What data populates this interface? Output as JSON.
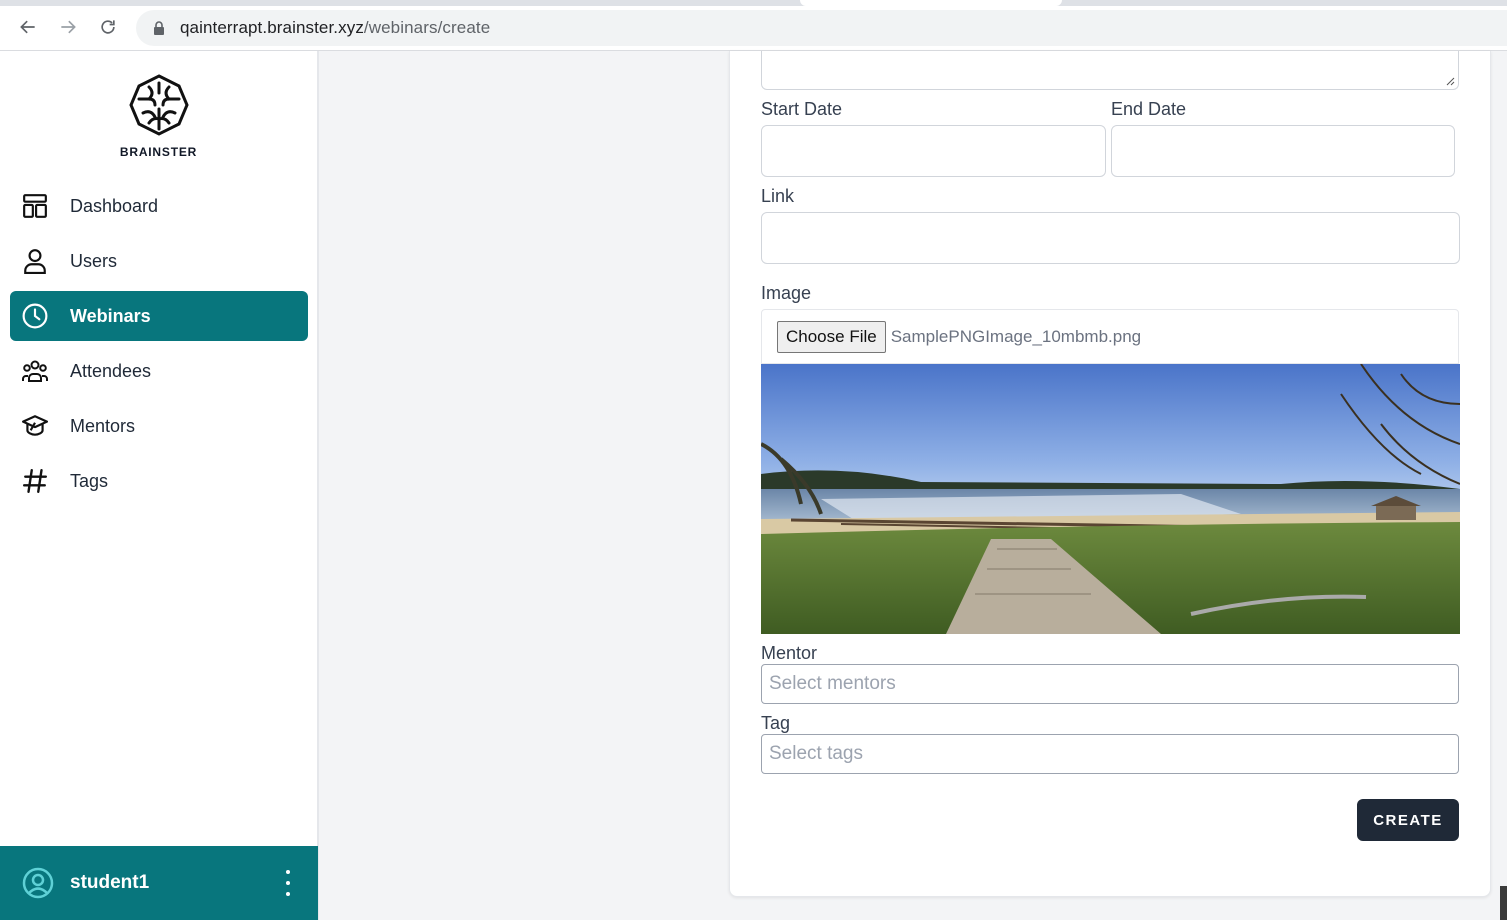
{
  "browser": {
    "url_host": "qainterrapt.brainster.xyz",
    "url_path": "/webinars/create"
  },
  "sidebar": {
    "logo_text": "BRAINSTER",
    "items": [
      {
        "label": "Dashboard",
        "icon": "dashboard-icon"
      },
      {
        "label": "Users",
        "icon": "user-icon"
      },
      {
        "label": "Webinars",
        "icon": "clock-icon",
        "active": true
      },
      {
        "label": "Attendees",
        "icon": "group-icon"
      },
      {
        "label": "Mentors",
        "icon": "graduation-cap-icon"
      },
      {
        "label": "Tags",
        "icon": "hashtag-icon"
      }
    ],
    "user": {
      "name": "student1",
      "icon": "user-circle-icon"
    }
  },
  "form": {
    "start_date_label": "Start Date",
    "end_date_label": "End Date",
    "link_label": "Link",
    "image_label": "Image",
    "choose_file_label": "Choose File",
    "file_name": "SamplePNGImage_10mbmb.png",
    "mentor_label": "Mentor",
    "mentor_placeholder": "Select mentors",
    "tag_label": "Tag",
    "tag_placeholder": "Select tags",
    "create_label": "CREATE"
  },
  "colors": {
    "accent": "#08767d",
    "button_dark": "#1f2937"
  }
}
